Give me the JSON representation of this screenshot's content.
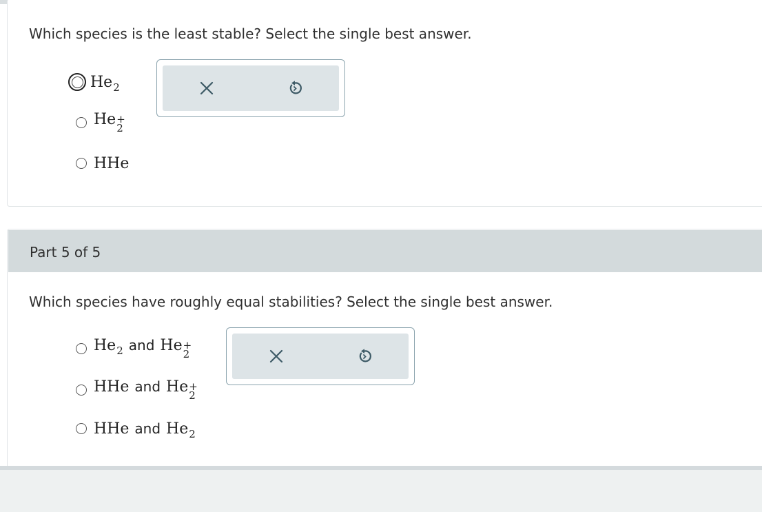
{
  "part4": {
    "question": "Which species is the least stable? Select the single best answer.",
    "options": [
      {
        "base": "He",
        "sub": "2",
        "sup": ""
      },
      {
        "base": "He",
        "sub": "2",
        "sup": "+"
      },
      {
        "base": "HHe",
        "sub": "",
        "sup": ""
      }
    ]
  },
  "part5": {
    "header": "Part 5 of 5",
    "question": "Which species have roughly equal stabilities? Select the single best answer.",
    "conjunction": "and",
    "options": [
      {
        "a_base": "He",
        "a_sub": "2",
        "b_base": "He",
        "b_sub": "2",
        "b_sup": "+"
      },
      {
        "a_base": "HHe",
        "a_sub": "",
        "b_base": "He",
        "b_sub": "2",
        "b_sup": "+"
      },
      {
        "a_base": "HHe",
        "a_sub": "",
        "b_base": "He",
        "b_sub": "2",
        "b_sup": ""
      }
    ]
  },
  "actions": {
    "clear_icon": "close-icon",
    "reset_icon": "undo-icon"
  },
  "colors": {
    "icon": "#3d5a66",
    "header_bg": "#d3dadc"
  }
}
